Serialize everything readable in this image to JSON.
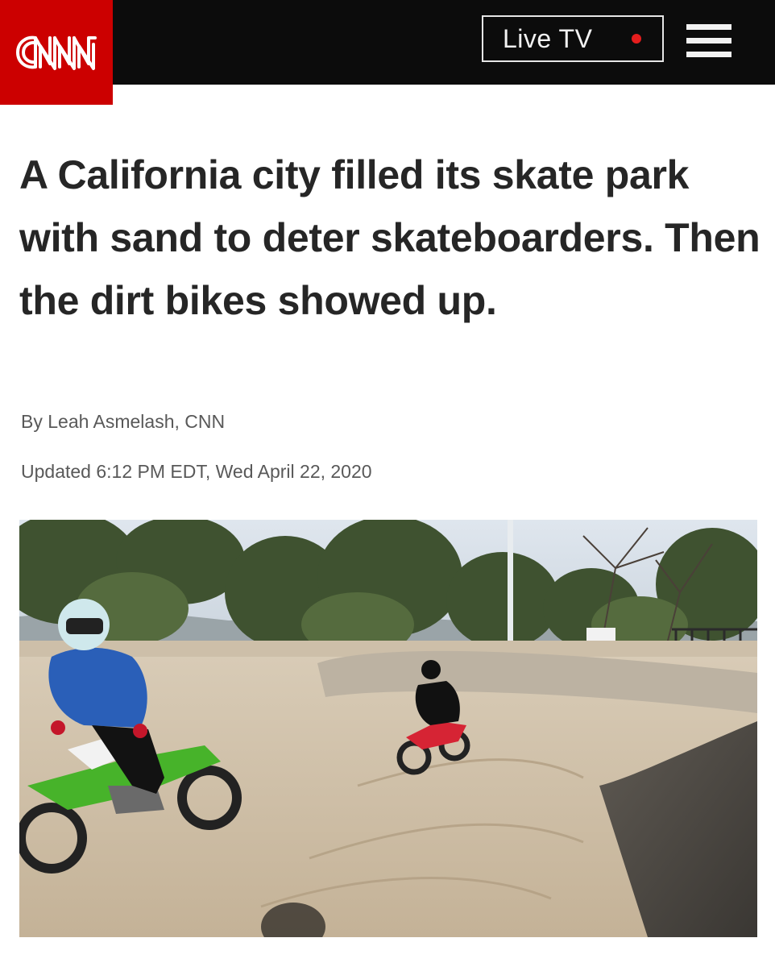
{
  "header": {
    "logo_text": "CNN",
    "live_tv_label": "Live TV",
    "live_indicator_color": "#e51d1d",
    "menu_icon": "hamburger-menu-icon",
    "brand_color": "#cc0000"
  },
  "article": {
    "headline": "A California city filled its skate park with sand to deter skateboarders. Then the dirt bikes showed up.",
    "byline": "By Leah Asmelash, CNN",
    "updated": "Updated 6:12 PM EDT, Wed April 22, 2020"
  },
  "media": {
    "image_subject": "dirt-bike-riders-in-sand-filled-skate-park-photo"
  }
}
